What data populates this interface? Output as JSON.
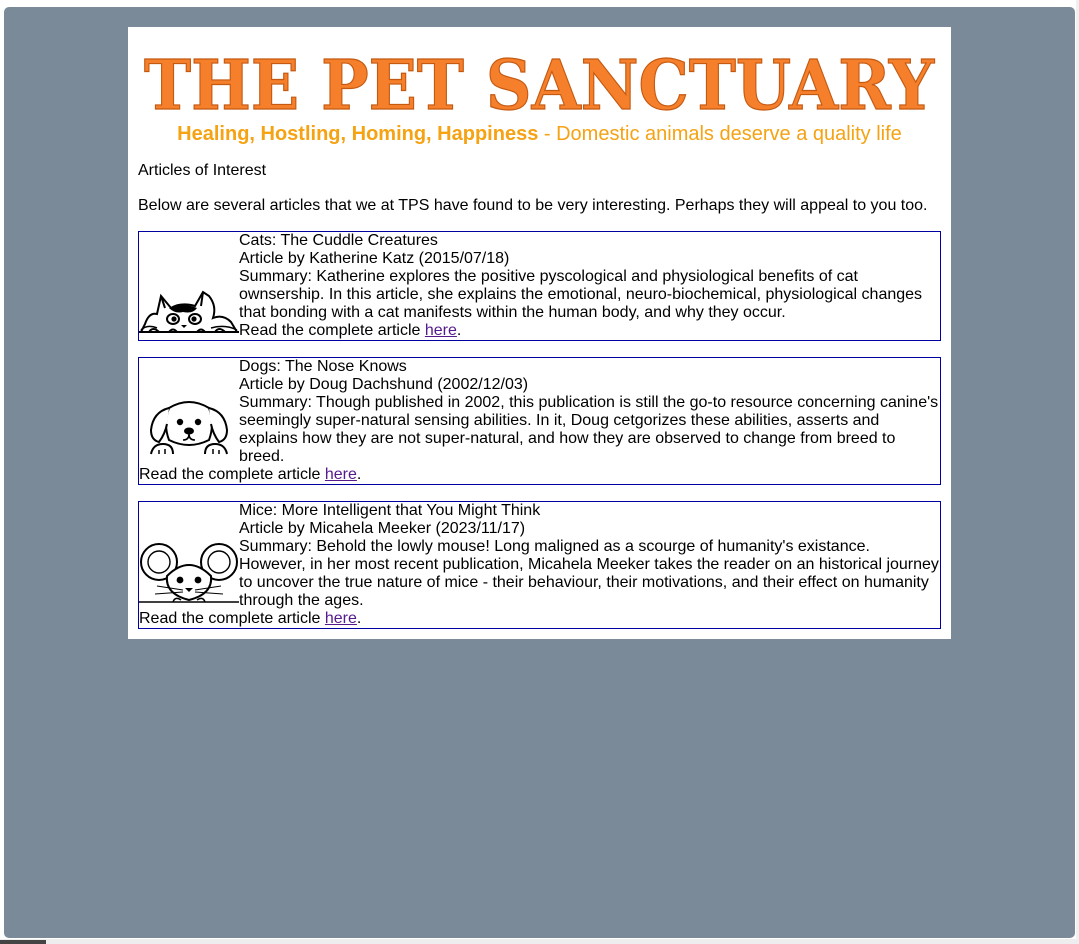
{
  "site": {
    "title": "THE PET SANCTUARY",
    "tagline_strong": "Healing, Hostling, Homing, Happiness",
    "tagline_rest": " - Domestic animals deserve a quality life"
  },
  "section_heading": "Articles of Interest",
  "intro": "Below are several articles that we at TPS have found to be very interesting. Perhaps they will appeal to you too.",
  "colors": {
    "frame": "#7b8a99",
    "title": "#f57f2a",
    "tagline": "#f5a213",
    "article_border": "#0000a0",
    "link": "#551a8b"
  },
  "articles": [
    {
      "icon": "cat-icon",
      "title": "Cats: The Cuddle Creatures",
      "byline": "Article by Katherine Katz (2015/07/18)",
      "summary": "Summary: Katherine explores the positive pyscological and physiological benefits of cat ownsership. In this article, she explains the emotional, neuro-biochemical, physiological changes that bonding with a cat manifests within the human body, and why they occur.",
      "read_prefix": "Read the complete article ",
      "link_text": "here",
      "read_suffix": "."
    },
    {
      "icon": "dog-icon",
      "title": "Dogs: The Nose Knows",
      "byline": "Article by Doug Dachshund (2002/12/03)",
      "summary": "Summary: Though published in 2002, this publication is still the go-to resource concerning canine's seemingly super-natural sensing abilities. In it, Doug cetgorizes these abilities, asserts and explains how they are not super-natural, and how they are observed to change from breed to breed.",
      "read_prefix": "Read the complete article ",
      "link_text": "here",
      "read_suffix": "."
    },
    {
      "icon": "mouse-icon",
      "title": "Mice: More Intelligent that You Might Think",
      "byline": "Article by Micahela Meeker (2023/11/17)",
      "summary": "Summary: Behold the lowly mouse! Long maligned as a scourge of humanity's existance. However, in her most recent publication, Micahela Meeker takes the reader on an historical journey to uncover the true nature of mice - their behaviour, their motivations, and their effect on humanity through the ages.",
      "read_prefix": "Read the complete article ",
      "link_text": "here",
      "read_suffix": "."
    }
  ]
}
